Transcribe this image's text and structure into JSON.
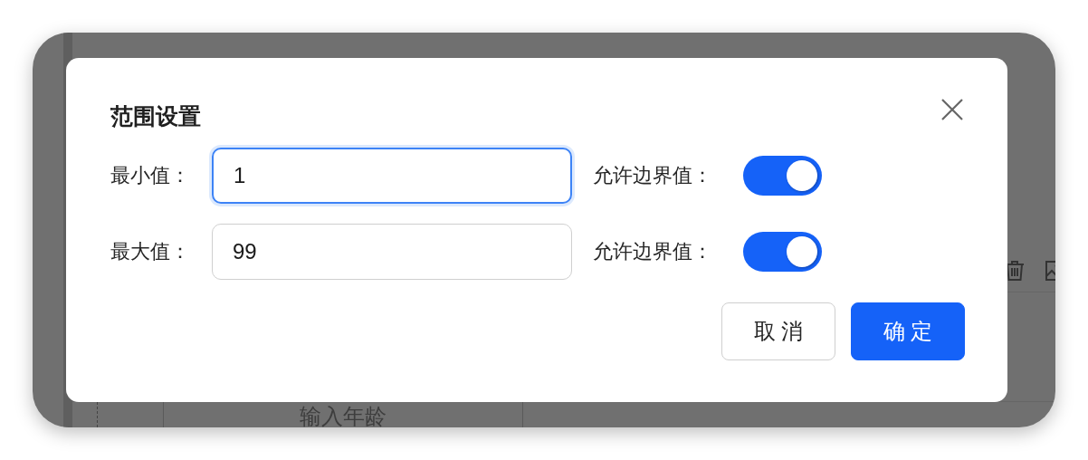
{
  "background": {
    "cell_placeholder": "输入年龄"
  },
  "dialog": {
    "title": "范围设置",
    "fields": [
      {
        "label": "最小值：",
        "value": "1",
        "focused": true,
        "boundary_label": "允许边界值：",
        "allow_boundary": true
      },
      {
        "label": "最大值：",
        "value": "99",
        "focused": false,
        "boundary_label": "允许边界值：",
        "allow_boundary": true
      }
    ],
    "buttons": [
      {
        "label": "取 消",
        "kind": "secondary"
      },
      {
        "label": "确 定",
        "kind": "primary"
      }
    ]
  }
}
